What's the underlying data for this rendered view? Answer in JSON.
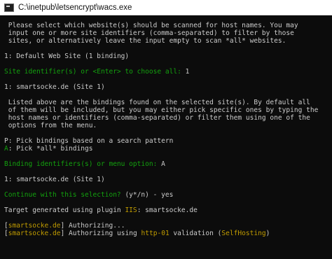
{
  "window": {
    "title": "C:\\inetpub\\letsencrypt\\wacs.exe",
    "app_icon": "console-icon"
  },
  "colors": {
    "background": "#0c0c0c",
    "text": "#cccccc",
    "green": "#13a10e",
    "yellow": "#c19c00"
  },
  "console": {
    "intro": [
      " Please select which website(s) should be scanned for host names. You may",
      " input one or more site identifiers (comma-separated) to filter by those",
      " sites, or alternatively leave the input empty to scan *all* websites."
    ],
    "site_option": {
      "key": "1",
      "text": ": Default Web Site (1 binding)"
    },
    "site_prompt": {
      "label": "Site identifier(s) or <Enter> to choose all: ",
      "answer": "1"
    },
    "binding_found": {
      "key": "1",
      "text": ": smartsocke.de (Site 1)"
    },
    "listed_text": [
      " Listed above are the bindings found on the selected site(s). By default all",
      " of them will be included, but you may either pick specific ones by typing the",
      " host names or identifiers (comma-separated) or filter them using one of the",
      " options from the menu."
    ],
    "menu_p": {
      "key": "P",
      "text": ": Pick bindings based on a search pattern"
    },
    "menu_a": {
      "key": "A",
      "text": ": Pick *all* bindings"
    },
    "binding_prompt": {
      "label": "Binding identifiers(s) or menu option: ",
      "answer": "A"
    },
    "binding_selected": {
      "key": "1",
      "text": ": smartsocke.de (Site 1)"
    },
    "continue_prompt": {
      "label": "Continue with this selection? ",
      "choice": "(y*/n)",
      "answer": " - yes"
    },
    "target": {
      "prefix": "Target generated using plugin ",
      "plugin": "IIS",
      "suffix": ": smartsocke.de"
    },
    "log1": {
      "open": "[",
      "host": "smartsocke.de",
      "close": "] Authorizing..."
    },
    "log2": {
      "open": "[",
      "host": "smartsocke.de",
      "mid": "] Authorizing using ",
      "method": "http-01",
      "mid2": " validation (",
      "plugin": "SelfHosting",
      "close": ")"
    }
  }
}
